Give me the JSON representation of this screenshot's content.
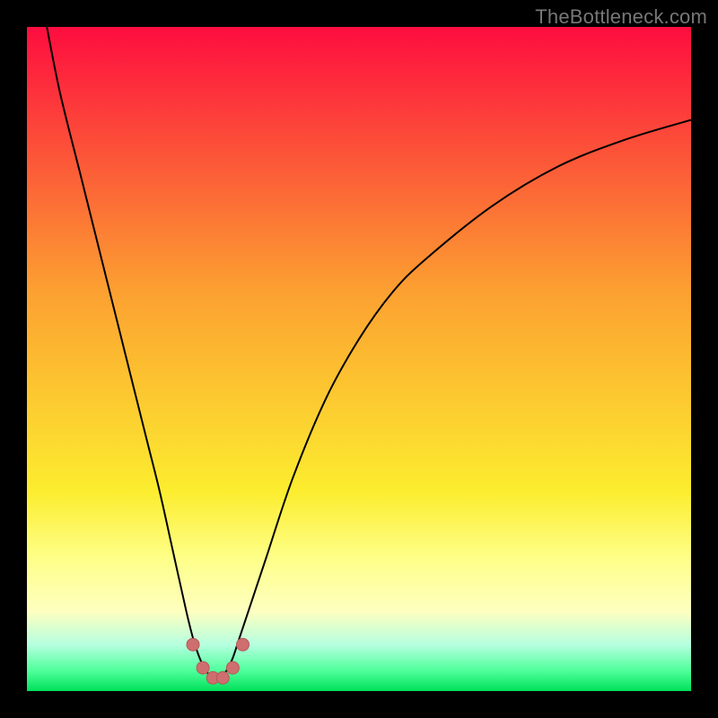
{
  "watermark": "TheBottleneck.com",
  "colors": {
    "bg": "#000000",
    "curve": "#000000",
    "marker_fill": "#cf6e6e",
    "marker_stroke": "#b45a5a",
    "gradient_top": "#fd0d3f",
    "gradient_mid1": "#fca131",
    "gradient_mid2": "#fced2f",
    "gradient_band": "#feff88",
    "gradient_green_light": "#6dffb0",
    "gradient_green": "#00e05a"
  },
  "chart_data": {
    "type": "line",
    "title": "",
    "xlabel": "",
    "ylabel": "",
    "xlim": [
      0,
      100
    ],
    "ylim": [
      0,
      100
    ],
    "grid": false,
    "legend": false,
    "series": [
      {
        "name": "bottleneck-curve",
        "x": [
          3,
          5,
          8,
          10,
          12,
          15,
          18,
          20,
          22,
          24,
          25,
          26,
          27,
          28,
          29,
          30,
          31,
          32,
          34,
          36,
          40,
          45,
          50,
          55,
          60,
          70,
          80,
          90,
          100
        ],
        "y": [
          100,
          90,
          78,
          70,
          62,
          50,
          38,
          30,
          21,
          12,
          8,
          5,
          3,
          2,
          2,
          3,
          5,
          8,
          14,
          20,
          32,
          44,
          53,
          60,
          65,
          73,
          79,
          83,
          86
        ]
      }
    ],
    "markers": {
      "name": "highlight-points",
      "x": [
        25,
        26.5,
        28,
        29.5,
        31,
        32.5
      ],
      "y": [
        7,
        3.5,
        2,
        2,
        3.5,
        7
      ]
    },
    "gradient_stops": [
      {
        "pos": 0.0,
        "color": "#fd0d3f"
      },
      {
        "pos": 0.4,
        "color": "#fca131"
      },
      {
        "pos": 0.7,
        "color": "#fced2f"
      },
      {
        "pos": 0.8,
        "color": "#feff88"
      },
      {
        "pos": 0.88,
        "color": "#feffc0"
      },
      {
        "pos": 0.93,
        "color": "#b6ffdf"
      },
      {
        "pos": 0.97,
        "color": "#4dff9a"
      },
      {
        "pos": 1.0,
        "color": "#00e05a"
      }
    ]
  }
}
